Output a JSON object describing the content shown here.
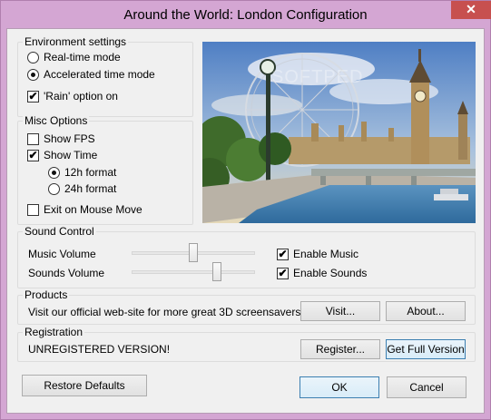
{
  "window": {
    "title": "Around the World: London Configuration",
    "close_glyph": "✕"
  },
  "environment": {
    "legend": "Environment settings",
    "realtime_label": "Real-time mode",
    "accelerated_label": "Accelerated time mode",
    "selected_mode": "accelerated",
    "rain_label": "'Rain' option on",
    "rain_checked": true
  },
  "misc": {
    "legend": "Misc Options",
    "show_fps_label": "Show FPS",
    "show_fps_checked": false,
    "show_time_label": "Show Time",
    "show_time_checked": true,
    "format12_label": "12h format",
    "format24_label": "24h format",
    "selected_format": "12h",
    "exit_label": "Exit on Mouse Move",
    "exit_checked": false
  },
  "preview": {
    "watermark": "SOFTPED",
    "colors": {
      "sky": "#7fa3d2",
      "water": "#3f7fb0",
      "parliament": "#b59a6a"
    }
  },
  "sound": {
    "legend": "Sound Control",
    "music_volume_label": "Music Volume",
    "music_volume_level": 0.5,
    "sounds_volume_label": "Sounds Volume",
    "sounds_volume_level": 0.71,
    "enable_music_label": "Enable Music",
    "enable_music_checked": true,
    "enable_sounds_label": "Enable Sounds",
    "enable_sounds_checked": true
  },
  "products": {
    "legend": "Products",
    "text": "Visit our official web-site for more great 3D screensavers",
    "visit_label": "Visit...",
    "about_label": "About..."
  },
  "registration": {
    "legend": "Registration",
    "status": "UNREGISTERED VERSION!",
    "register_label": "Register...",
    "full_version_label": "Get Full Version"
  },
  "footer": {
    "restore_label": "Restore Defaults",
    "ok_label": "OK",
    "cancel_label": "Cancel"
  },
  "check_glyph": "✔"
}
